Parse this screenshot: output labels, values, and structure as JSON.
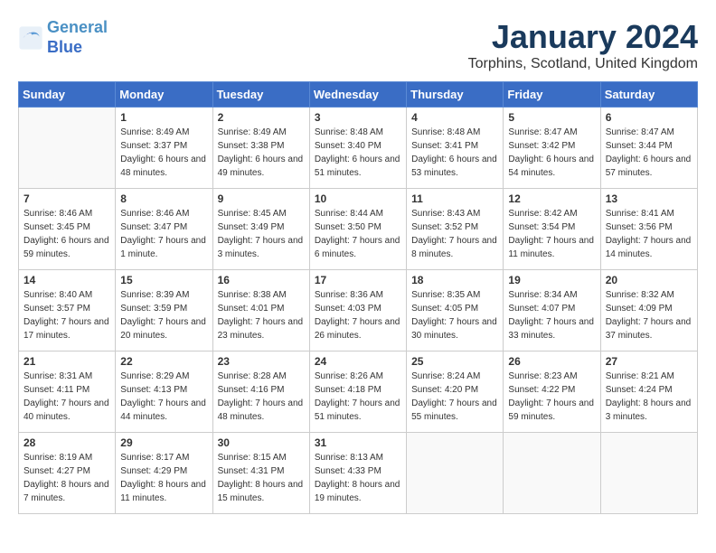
{
  "logo": {
    "line1": "General",
    "line2": "Blue"
  },
  "title": "January 2024",
  "location": "Torphins, Scotland, United Kingdom",
  "days_header": [
    "Sunday",
    "Monday",
    "Tuesday",
    "Wednesday",
    "Thursday",
    "Friday",
    "Saturday"
  ],
  "weeks": [
    [
      {
        "day": "",
        "sunrise": "",
        "sunset": "",
        "daylight": ""
      },
      {
        "day": "1",
        "sunrise": "Sunrise: 8:49 AM",
        "sunset": "Sunset: 3:37 PM",
        "daylight": "Daylight: 6 hours and 48 minutes."
      },
      {
        "day": "2",
        "sunrise": "Sunrise: 8:49 AM",
        "sunset": "Sunset: 3:38 PM",
        "daylight": "Daylight: 6 hours and 49 minutes."
      },
      {
        "day": "3",
        "sunrise": "Sunrise: 8:48 AM",
        "sunset": "Sunset: 3:40 PM",
        "daylight": "Daylight: 6 hours and 51 minutes."
      },
      {
        "day": "4",
        "sunrise": "Sunrise: 8:48 AM",
        "sunset": "Sunset: 3:41 PM",
        "daylight": "Daylight: 6 hours and 53 minutes."
      },
      {
        "day": "5",
        "sunrise": "Sunrise: 8:47 AM",
        "sunset": "Sunset: 3:42 PM",
        "daylight": "Daylight: 6 hours and 54 minutes."
      },
      {
        "day": "6",
        "sunrise": "Sunrise: 8:47 AM",
        "sunset": "Sunset: 3:44 PM",
        "daylight": "Daylight: 6 hours and 57 minutes."
      }
    ],
    [
      {
        "day": "7",
        "sunrise": "Sunrise: 8:46 AM",
        "sunset": "Sunset: 3:45 PM",
        "daylight": "Daylight: 6 hours and 59 minutes."
      },
      {
        "day": "8",
        "sunrise": "Sunrise: 8:46 AM",
        "sunset": "Sunset: 3:47 PM",
        "daylight": "Daylight: 7 hours and 1 minute."
      },
      {
        "day": "9",
        "sunrise": "Sunrise: 8:45 AM",
        "sunset": "Sunset: 3:49 PM",
        "daylight": "Daylight: 7 hours and 3 minutes."
      },
      {
        "day": "10",
        "sunrise": "Sunrise: 8:44 AM",
        "sunset": "Sunset: 3:50 PM",
        "daylight": "Daylight: 7 hours and 6 minutes."
      },
      {
        "day": "11",
        "sunrise": "Sunrise: 8:43 AM",
        "sunset": "Sunset: 3:52 PM",
        "daylight": "Daylight: 7 hours and 8 minutes."
      },
      {
        "day": "12",
        "sunrise": "Sunrise: 8:42 AM",
        "sunset": "Sunset: 3:54 PM",
        "daylight": "Daylight: 7 hours and 11 minutes."
      },
      {
        "day": "13",
        "sunrise": "Sunrise: 8:41 AM",
        "sunset": "Sunset: 3:56 PM",
        "daylight": "Daylight: 7 hours and 14 minutes."
      }
    ],
    [
      {
        "day": "14",
        "sunrise": "Sunrise: 8:40 AM",
        "sunset": "Sunset: 3:57 PM",
        "daylight": "Daylight: 7 hours and 17 minutes."
      },
      {
        "day": "15",
        "sunrise": "Sunrise: 8:39 AM",
        "sunset": "Sunset: 3:59 PM",
        "daylight": "Daylight: 7 hours and 20 minutes."
      },
      {
        "day": "16",
        "sunrise": "Sunrise: 8:38 AM",
        "sunset": "Sunset: 4:01 PM",
        "daylight": "Daylight: 7 hours and 23 minutes."
      },
      {
        "day": "17",
        "sunrise": "Sunrise: 8:36 AM",
        "sunset": "Sunset: 4:03 PM",
        "daylight": "Daylight: 7 hours and 26 minutes."
      },
      {
        "day": "18",
        "sunrise": "Sunrise: 8:35 AM",
        "sunset": "Sunset: 4:05 PM",
        "daylight": "Daylight: 7 hours and 30 minutes."
      },
      {
        "day": "19",
        "sunrise": "Sunrise: 8:34 AM",
        "sunset": "Sunset: 4:07 PM",
        "daylight": "Daylight: 7 hours and 33 minutes."
      },
      {
        "day": "20",
        "sunrise": "Sunrise: 8:32 AM",
        "sunset": "Sunset: 4:09 PM",
        "daylight": "Daylight: 7 hours and 37 minutes."
      }
    ],
    [
      {
        "day": "21",
        "sunrise": "Sunrise: 8:31 AM",
        "sunset": "Sunset: 4:11 PM",
        "daylight": "Daylight: 7 hours and 40 minutes."
      },
      {
        "day": "22",
        "sunrise": "Sunrise: 8:29 AM",
        "sunset": "Sunset: 4:13 PM",
        "daylight": "Daylight: 7 hours and 44 minutes."
      },
      {
        "day": "23",
        "sunrise": "Sunrise: 8:28 AM",
        "sunset": "Sunset: 4:16 PM",
        "daylight": "Daylight: 7 hours and 48 minutes."
      },
      {
        "day": "24",
        "sunrise": "Sunrise: 8:26 AM",
        "sunset": "Sunset: 4:18 PM",
        "daylight": "Daylight: 7 hours and 51 minutes."
      },
      {
        "day": "25",
        "sunrise": "Sunrise: 8:24 AM",
        "sunset": "Sunset: 4:20 PM",
        "daylight": "Daylight: 7 hours and 55 minutes."
      },
      {
        "day": "26",
        "sunrise": "Sunrise: 8:23 AM",
        "sunset": "Sunset: 4:22 PM",
        "daylight": "Daylight: 7 hours and 59 minutes."
      },
      {
        "day": "27",
        "sunrise": "Sunrise: 8:21 AM",
        "sunset": "Sunset: 4:24 PM",
        "daylight": "Daylight: 8 hours and 3 minutes."
      }
    ],
    [
      {
        "day": "28",
        "sunrise": "Sunrise: 8:19 AM",
        "sunset": "Sunset: 4:27 PM",
        "daylight": "Daylight: 8 hours and 7 minutes."
      },
      {
        "day": "29",
        "sunrise": "Sunrise: 8:17 AM",
        "sunset": "Sunset: 4:29 PM",
        "daylight": "Daylight: 8 hours and 11 minutes."
      },
      {
        "day": "30",
        "sunrise": "Sunrise: 8:15 AM",
        "sunset": "Sunset: 4:31 PM",
        "daylight": "Daylight: 8 hours and 15 minutes."
      },
      {
        "day": "31",
        "sunrise": "Sunrise: 8:13 AM",
        "sunset": "Sunset: 4:33 PM",
        "daylight": "Daylight: 8 hours and 19 minutes."
      },
      {
        "day": "",
        "sunrise": "",
        "sunset": "",
        "daylight": ""
      },
      {
        "day": "",
        "sunrise": "",
        "sunset": "",
        "daylight": ""
      },
      {
        "day": "",
        "sunrise": "",
        "sunset": "",
        "daylight": ""
      }
    ]
  ]
}
